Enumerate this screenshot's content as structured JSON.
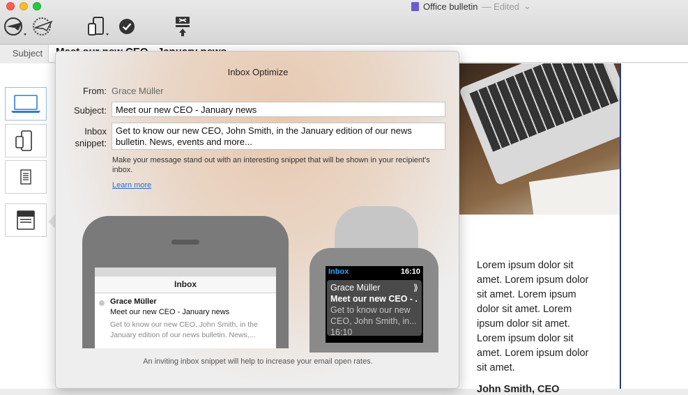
{
  "window": {
    "title": "Office bulletin",
    "status": "— Edited"
  },
  "subject_bar": {
    "label": "Subject",
    "value": "Meet our new CEO - January news"
  },
  "popover": {
    "title": "Inbox Optimize",
    "from_label": "From:",
    "from_value": "Grace Müller",
    "subject_label": "Subject:",
    "subject_value": "Meet our new CEO - January news",
    "snippet_label_1": "Inbox",
    "snippet_label_2": "snippet:",
    "snippet_value": "Get to know our new CEO, John Smith, in the January edition of our news bulletin. News, events and more...",
    "hint": "Make your message stand out with an interesting snippet that will be shown in your recipient's inbox.",
    "learn_more": "Learn more",
    "footer": "An inviting inbox snippet will help to increase your email open rates."
  },
  "phone": {
    "inbox_title": "Inbox",
    "from": "Grace Müller",
    "subject": "Meet our new CEO - January news",
    "snippet": "Get to know our new CEO, John Smith, in the January edition of our news bulletin. News,..."
  },
  "watch": {
    "inbox": "Inbox",
    "time": "16:10",
    "from": "Grace Müller",
    "chevron": "⟫",
    "subject": "Meet our new CEO - .",
    "snippet": "Get to know our new CEO, John Smith, in...",
    "footer_time": "16:10"
  },
  "preview": {
    "lorem": "Lorem ipsum dolor sit amet. Lorem ipsum dolor sit amet. Lorem ipsum dolor sit amet. Lorem ipsum dolor sit amet. Lorem ipsum dolor sit amet. Lorem ipsum dolor sit amet.",
    "partial": "John Smith, CEO"
  },
  "icons": [
    "send-icon",
    "schedule-send-icon",
    "devices-icon",
    "check-icon",
    "inbox-optimize-icon",
    "laptop-icon",
    "phone-tablet-icon",
    "document-icon",
    "inbox-preview-icon"
  ]
}
